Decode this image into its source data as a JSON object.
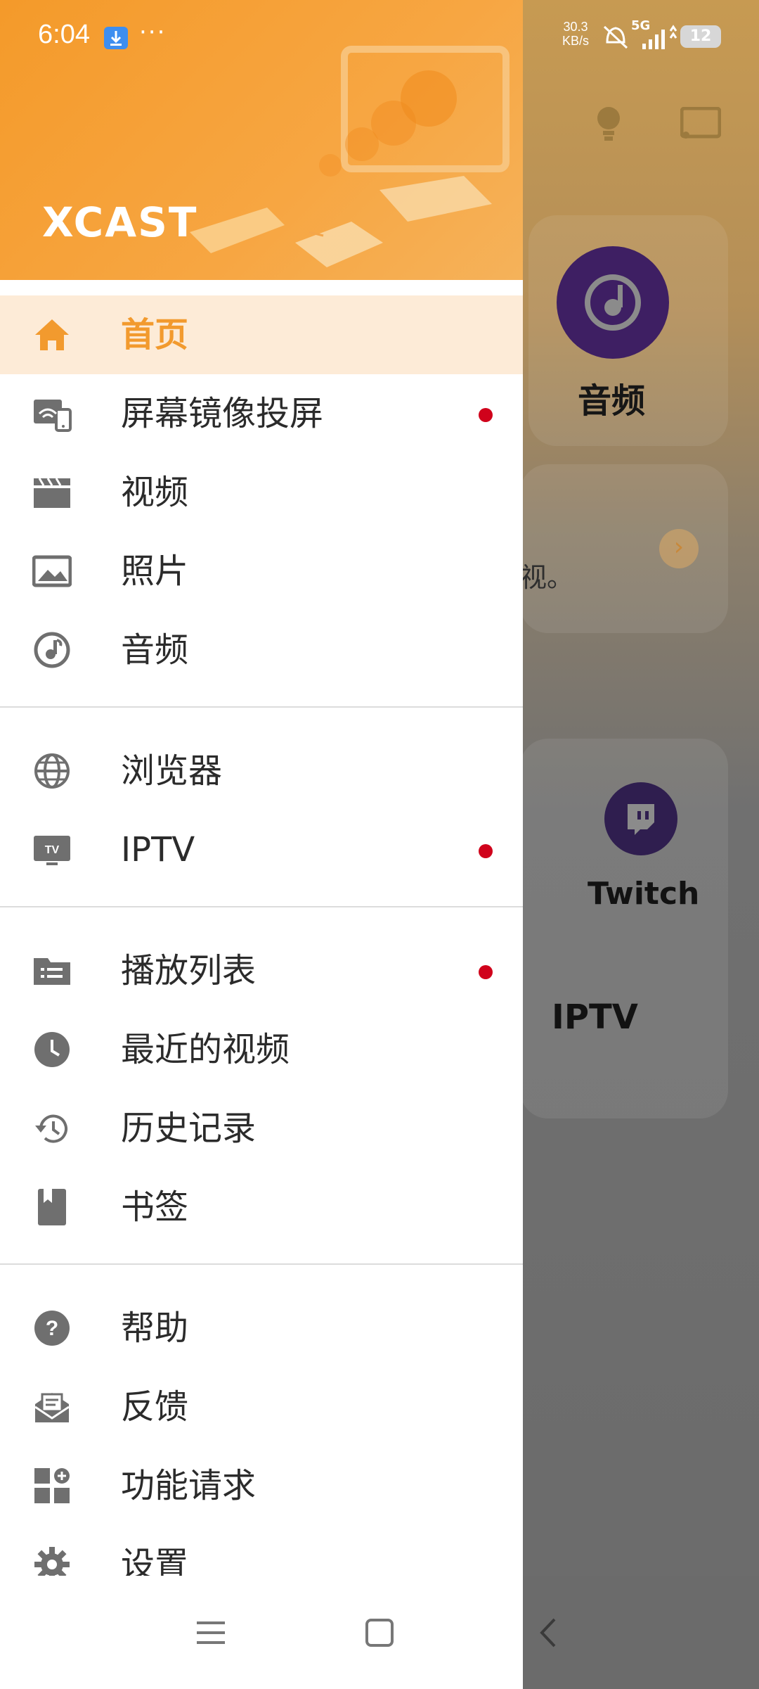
{
  "status_bar": {
    "time": "6:04",
    "more": "···",
    "net_speed_value": "30.3",
    "net_speed_unit": "KB/s",
    "network": "5G",
    "battery": "12"
  },
  "header": {
    "logo": "XCAST"
  },
  "menu": {
    "sections": [
      {
        "items": [
          {
            "label": "首页",
            "icon": "home-icon",
            "active": true,
            "badge": false
          },
          {
            "label": "屏幕镜像投屏",
            "icon": "screen-mirror-icon",
            "active": false,
            "badge": true
          },
          {
            "label": "视频",
            "icon": "video-clapper-icon",
            "active": false,
            "badge": false
          },
          {
            "label": "照片",
            "icon": "photo-icon",
            "active": false,
            "badge": false
          },
          {
            "label": "音频",
            "icon": "audio-icon",
            "active": false,
            "badge": false
          }
        ]
      },
      {
        "items": [
          {
            "label": "浏览器",
            "icon": "globe-icon",
            "active": false,
            "badge": false
          },
          {
            "label": "IPTV",
            "icon": "tv-icon",
            "active": false,
            "badge": true
          }
        ]
      },
      {
        "items": [
          {
            "label": "播放列表",
            "icon": "playlist-folder-icon",
            "active": false,
            "badge": true
          },
          {
            "label": "最近的视频",
            "icon": "clock-icon",
            "active": false,
            "badge": false
          },
          {
            "label": "历史记录",
            "icon": "history-icon",
            "active": false,
            "badge": false
          },
          {
            "label": "书签",
            "icon": "bookmark-icon",
            "active": false,
            "badge": false
          }
        ]
      },
      {
        "items": [
          {
            "label": "帮助",
            "icon": "help-icon",
            "active": false,
            "badge": false
          },
          {
            "label": "反馈",
            "icon": "feedback-mail-icon",
            "active": false,
            "badge": false
          },
          {
            "label": "功能请求",
            "icon": "feature-request-icon",
            "active": false,
            "badge": false
          },
          {
            "label": "设置",
            "icon": "gear-icon",
            "active": false,
            "badge": false
          }
        ]
      }
    ]
  },
  "background_app": {
    "audio_label": "音频",
    "snippet_text": "视。",
    "twitch_label": "Twitch",
    "iptv_label": "IPTV"
  },
  "colors": {
    "accent": "#f29a2e",
    "active_bg": "#fdebd7",
    "badge": "#d0021b",
    "icon_gray": "#6f6f6f"
  }
}
